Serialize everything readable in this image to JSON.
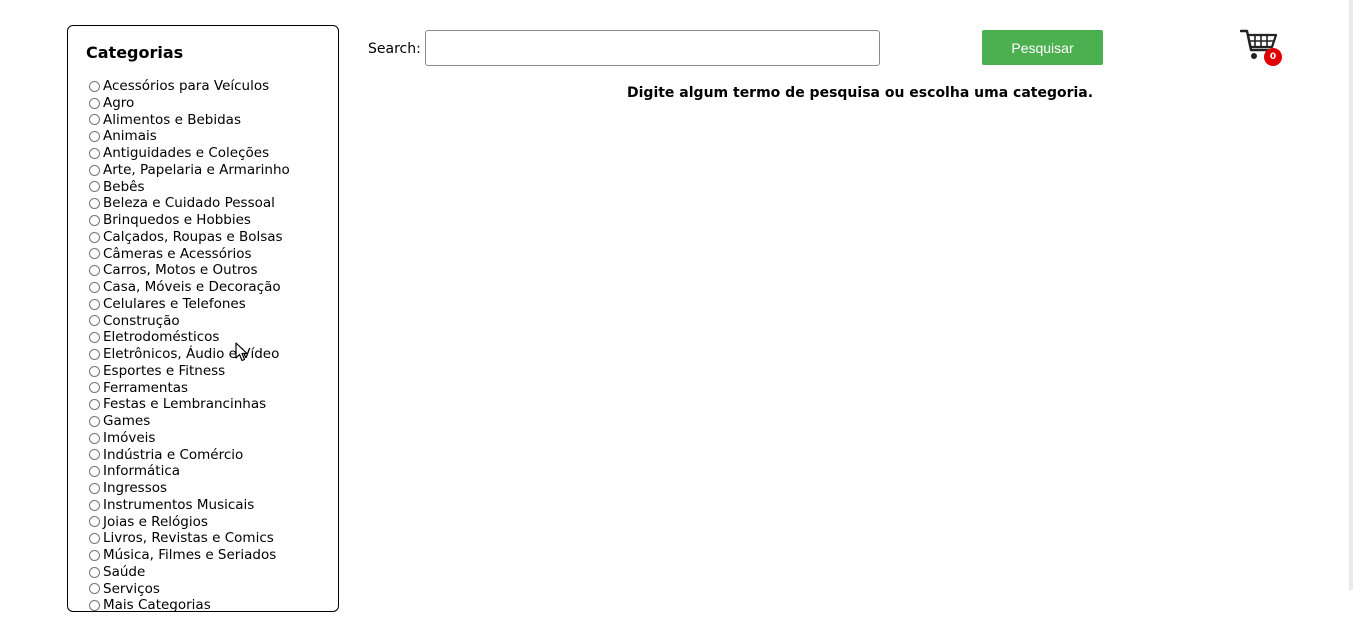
{
  "sidebar": {
    "title": "Categorias",
    "categories": [
      "Acessórios para Veículos",
      "Agro",
      "Alimentos e Bebidas",
      "Animais",
      "Antiguidades e Coleções",
      "Arte, Papelaria e Armarinho",
      "Bebês",
      "Beleza e Cuidado Pessoal",
      "Brinquedos e Hobbies",
      "Calçados, Roupas e Bolsas",
      "Câmeras e Acessórios",
      "Carros, Motos e Outros",
      "Casa, Móveis e Decoração",
      "Celulares e Telefones",
      "Construção",
      "Eletrodomésticos",
      "Eletrônicos, Áudio e Vídeo",
      "Esportes e Fitness",
      "Ferramentas",
      "Festas e Lembrancinhas",
      "Games",
      "Imóveis",
      "Indústria e Comércio",
      "Informática",
      "Ingressos",
      "Instrumentos Musicais",
      "Joias e Relógios",
      "Livros, Revistas e Comics",
      "Música, Filmes e Seriados",
      "Saúde",
      "Serviços",
      "Mais Categorias"
    ]
  },
  "search": {
    "label": "Search:",
    "value": "",
    "button_label": "Pesquisar"
  },
  "cart": {
    "icon": "shopping-cart-icon",
    "count": "0"
  },
  "main": {
    "message": "Digite algum termo de pesquisa ou escolha uma categoria."
  },
  "colors": {
    "button": "#4caf50",
    "badge": "#e00000"
  }
}
